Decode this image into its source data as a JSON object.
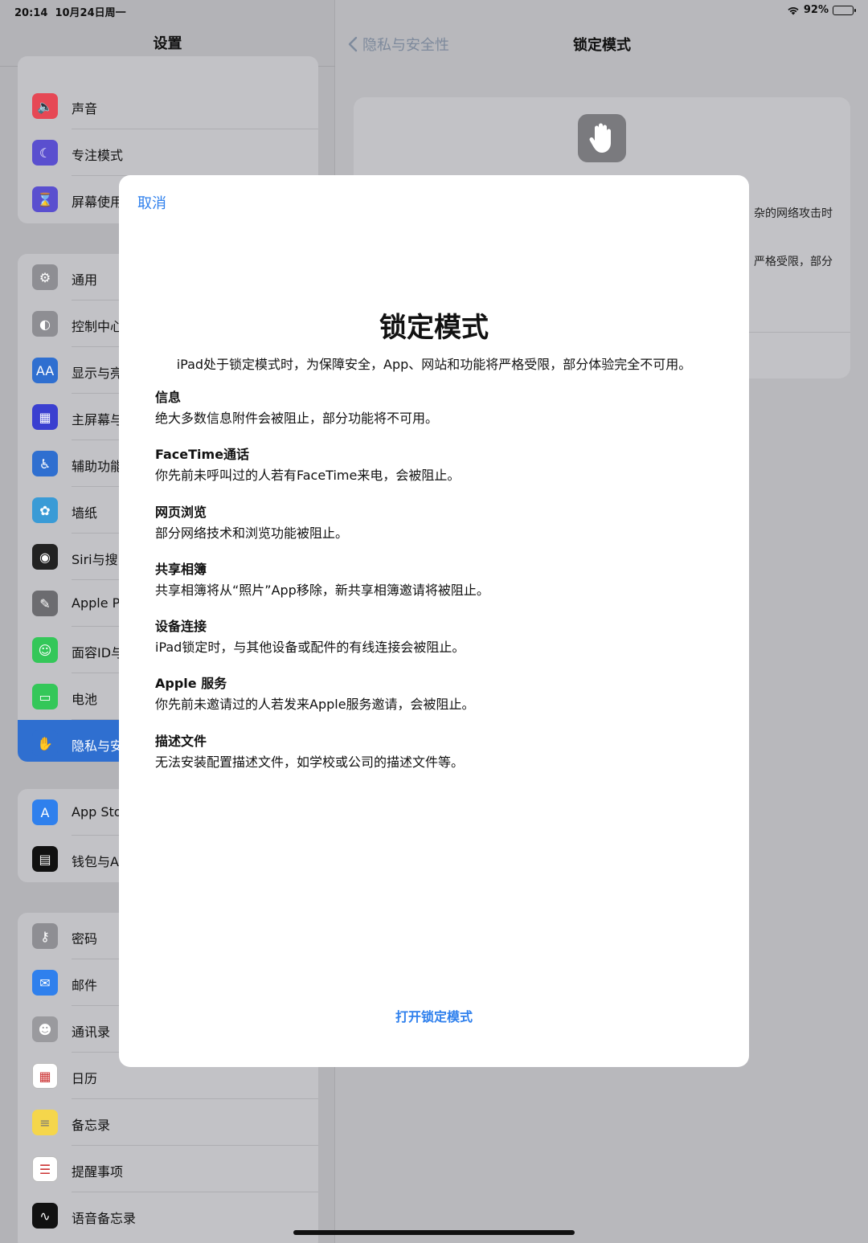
{
  "status": {
    "time": "20:14",
    "date": "10月24日周一",
    "battery": "92%",
    "battery_level": 0.92
  },
  "sidebar": {
    "title": "设置",
    "groups": [
      {
        "items": [
          {
            "label": "声音",
            "icon": "speaker-icon",
            "color": "#e64855"
          },
          {
            "label": "专注模式",
            "icon": "moon-icon",
            "color": "#5a4fcf"
          },
          {
            "label": "屏幕使用",
            "icon": "hourglass-icon",
            "color": "#5a4fcf"
          }
        ]
      },
      {
        "items": [
          {
            "label": "通用",
            "icon": "gear-icon",
            "color": "#8e8e93"
          },
          {
            "label": "控制中心",
            "icon": "toggles-icon",
            "color": "#8e8e93"
          },
          {
            "label": "显示与亮",
            "icon": "text-size-icon",
            "color": "#2f6fd0"
          },
          {
            "label": "主屏幕与",
            "icon": "grid-icon",
            "color": "#3a3fd0"
          },
          {
            "label": "辅助功能",
            "icon": "accessibility-icon",
            "color": "#2f6fd0"
          },
          {
            "label": "墙纸",
            "icon": "flower-icon",
            "color": "#3a9bd6"
          },
          {
            "label": "Siri与搜",
            "icon": "siri-icon",
            "color": "#222222"
          },
          {
            "label": "Apple P",
            "icon": "pencil-icon",
            "color": "#6c6c70"
          },
          {
            "label": "面容ID与",
            "icon": "face-id-icon",
            "color": "#34c759"
          },
          {
            "label": "电池",
            "icon": "battery-icon",
            "color": "#34c759"
          },
          {
            "label": "隐私与安",
            "icon": "hand-icon",
            "color": "#2f6fd0",
            "selected": true
          }
        ]
      },
      {
        "items": [
          {
            "label": "App Sto",
            "icon": "app-store-icon",
            "color": "#2f80ed"
          },
          {
            "label": "钱包与A",
            "icon": "wallet-icon",
            "color": "#111111"
          }
        ]
      },
      {
        "items": [
          {
            "label": "密码",
            "icon": "key-icon",
            "color": "#8e8e93"
          },
          {
            "label": "邮件",
            "icon": "mail-icon",
            "color": "#2f80ed"
          },
          {
            "label": "通讯录",
            "icon": "contacts-icon",
            "color": "#9a9a9e"
          },
          {
            "label": "日历",
            "icon": "calendar-icon",
            "color": "#ffffff"
          },
          {
            "label": "备忘录",
            "icon": "notes-icon",
            "color": "#f5d64b"
          },
          {
            "label": "提醒事项",
            "icon": "reminders-icon",
            "color": "#ffffff"
          },
          {
            "label": "语音备忘录",
            "icon": "voice-memo-icon",
            "color": "#111111"
          }
        ]
      }
    ]
  },
  "detail": {
    "back_label": "隐私与安全性",
    "title": "锁定模式",
    "card_fragment_1": "杂的网络攻击时",
    "card_fragment_2": "严格受限，部分"
  },
  "modal": {
    "cancel_label": "取消",
    "title": "锁定模式",
    "intro": "iPad处于锁定模式时，为保障安全，App、网站和功能将严格受限，部分体验完全不可用。",
    "sections": [
      {
        "heading": "信息",
        "body": "绝大多数信息附件会被阻止，部分功能将不可用。"
      },
      {
        "heading": "FaceTime通话",
        "body": "你先前未呼叫过的人若有FaceTime来电，会被阻止。"
      },
      {
        "heading": "网页浏览",
        "body": "部分网络技术和浏览功能被阻止。"
      },
      {
        "heading": "共享相簿",
        "body": "共享相簿将从“照片”App移除，新共享相簿邀请将被阻止。"
      },
      {
        "heading": "设备连接",
        "body": "iPad锁定时，与其他设备或配件的有线连接会被阻止。"
      },
      {
        "heading": "Apple 服务",
        "body": "你先前未邀请过的人若发来Apple服务邀请，会被阻止。"
      },
      {
        "heading": "描述文件",
        "body": "无法安装配置描述文件，如学校或公司的描述文件等。"
      }
    ],
    "open_button_label": "打开锁定模式"
  },
  "colors": {
    "accent": "#2f80ed",
    "selected_row": "#2f6fd0"
  }
}
